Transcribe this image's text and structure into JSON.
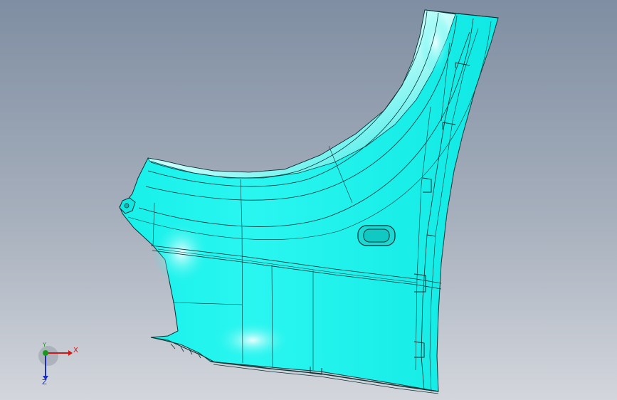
{
  "window": {
    "title": ""
  },
  "viewport": {
    "background_top": "#7f8ea2",
    "background_bottom": "#d3d6dc",
    "part_fill": "#15f2ec",
    "part_highlight": "#e9fffe",
    "edge_color": "#0a3336"
  },
  "axis_triad": {
    "x_label": "X",
    "y_label": "Y",
    "z_label": "Z",
    "x_color": "#d01818",
    "y_color": "#1a9a1a",
    "z_color": "#1a2fbf"
  }
}
